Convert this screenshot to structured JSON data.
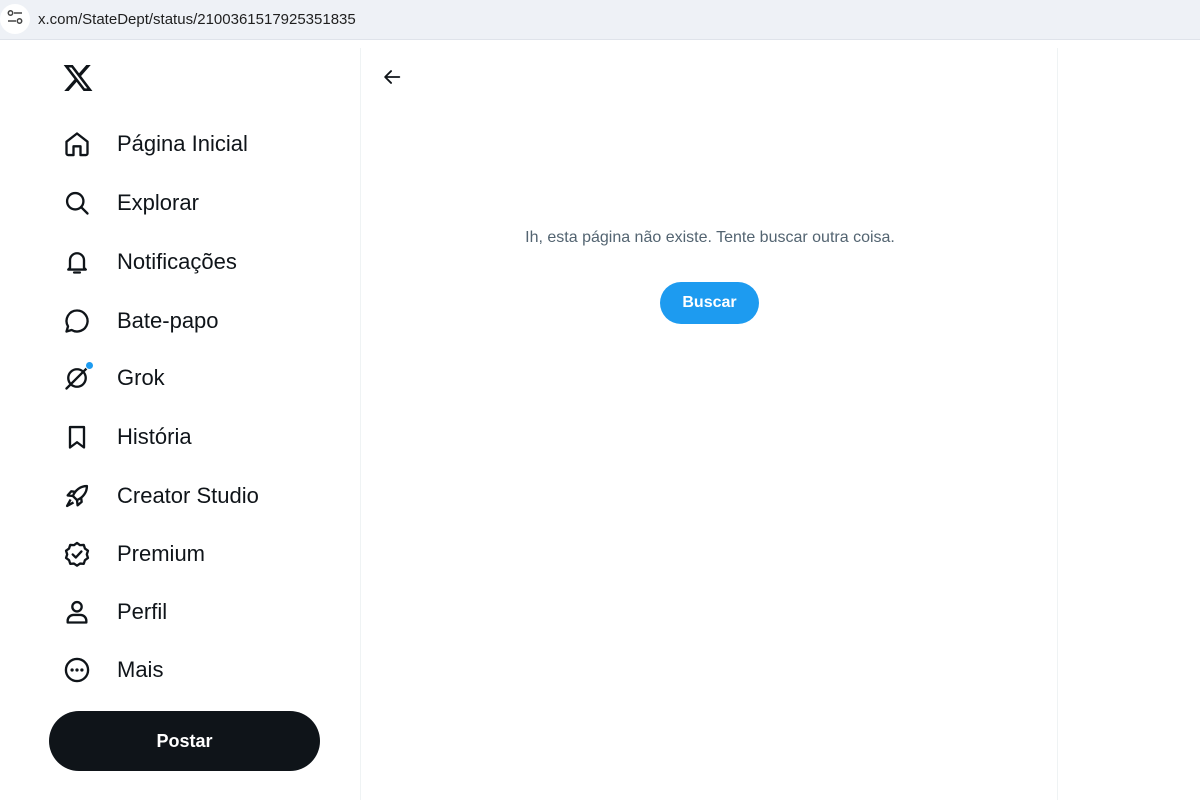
{
  "browser": {
    "url": "x.com/StateDept/status/2100361517925351835",
    "site_info_icon": "tune-icon"
  },
  "sidebar": {
    "logo_icon": "x-logo-icon",
    "items": [
      {
        "label": "Página Inicial",
        "icon": "home-icon"
      },
      {
        "label": "Explorar",
        "icon": "search-icon"
      },
      {
        "label": "Notificações",
        "icon": "bell-icon"
      },
      {
        "label": "Bate-papo",
        "icon": "chat-bubble-icon"
      },
      {
        "label": "Grok",
        "icon": "grok-icon"
      },
      {
        "label": "História",
        "icon": "bookmark-icon"
      },
      {
        "label": "Creator Studio",
        "icon": "rocket-icon"
      },
      {
        "label": "Premium",
        "icon": "verified-badge-icon"
      },
      {
        "label": "Perfil",
        "icon": "person-icon"
      },
      {
        "label": "Mais",
        "icon": "more-circle-icon"
      }
    ],
    "post_label": "Postar"
  },
  "main": {
    "back_icon": "arrow-left-icon",
    "message": "Ih, esta página não existe. Tente buscar outra coisa.",
    "search_label": "Buscar"
  },
  "colors": {
    "accent": "#1d9bf0",
    "text": "#0f1419",
    "muted": "#536471"
  }
}
